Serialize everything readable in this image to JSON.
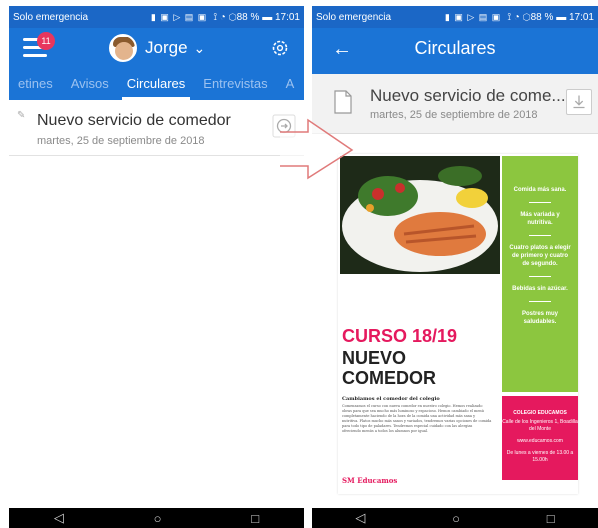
{
  "colors": {
    "statusbar": "#1b67c6",
    "appbar": "#1b74d6",
    "badge": "#e8365e",
    "poster_pink": "#e5195e",
    "poster_green": "#8cc63f",
    "callout": "#e07a7a"
  },
  "left": {
    "status": {
      "left": "Solo emergencia",
      "icons": "▮ ▣ ▷ ▤ ▣",
      "right": "⟟ ◔ ⬡88 % ▬ 17:01"
    },
    "header": {
      "badge_count": "11",
      "user_name": "Jorge",
      "chevron": "⌄",
      "menu_icon": "hamburger-icon",
      "settings_icon": "gear-icon"
    },
    "tabs": [
      {
        "label": "etines"
      },
      {
        "label": "Avisos"
      },
      {
        "label": "Circulares",
        "active": true
      },
      {
        "label": "Entrevistas"
      },
      {
        "label": "A"
      }
    ],
    "item": {
      "title": "Nuevo servicio de comedor",
      "date": "martes, 25 de septiembre de 2018",
      "clip": "✎"
    },
    "nav": {
      "back": "◁",
      "home": "○",
      "recents": "□"
    }
  },
  "right": {
    "status": {
      "left": "Solo emergencia",
      "icons": "▮ ▣ ▷ ▤ ▣",
      "right": "⟟ ◔ ⬡88 % ▬ 17:01"
    },
    "header": {
      "back": "←",
      "title": "Circulares"
    },
    "document": {
      "title": "Nuevo servicio de come...",
      "date": "martes, 25 de septiembre de 2018",
      "download_icon": "download-icon"
    },
    "poster": {
      "green_items": [
        "Comida más sana.",
        "Más variada y nutritiva.",
        "Cuatro platos a elegir de primero y cuatro de segundo.",
        "Bebidas sin azúcar.",
        "Postres muy saludables."
      ],
      "heading_1": "CURSO 18/19",
      "heading_2": "NUEVO",
      "heading_3": "COMEDOR",
      "subtitle": "Cambiamos el comedor del colegio",
      "body": "Comenzamos el curso con nueva comedor en nuestro colegio. Hemos realizado obras para que sea mucho más luminoso y espacioso. Hemos cambiado el menú completamente haciendo de la hora de la comida una actividad más sana y nutritiva. Platos mucho más sanos y variados, tendremos varias opciones de comida para todo tipo de paladares. Tendremos especial cuidado con las alergias ofreciendo menús a todos los alumnos por igual.",
      "brand": "SM Educamos",
      "pink_title": "COLEGIO EDUCAMOS",
      "pink_address": "Calle de los Ingenieros 1, Boadilla del Monte",
      "pink_web": "www.educamos.com",
      "pink_hours": "De lunes a viernes de 13.00 a 15.00h"
    },
    "nav": {
      "back": "◁",
      "home": "○",
      "recents": "□"
    }
  }
}
